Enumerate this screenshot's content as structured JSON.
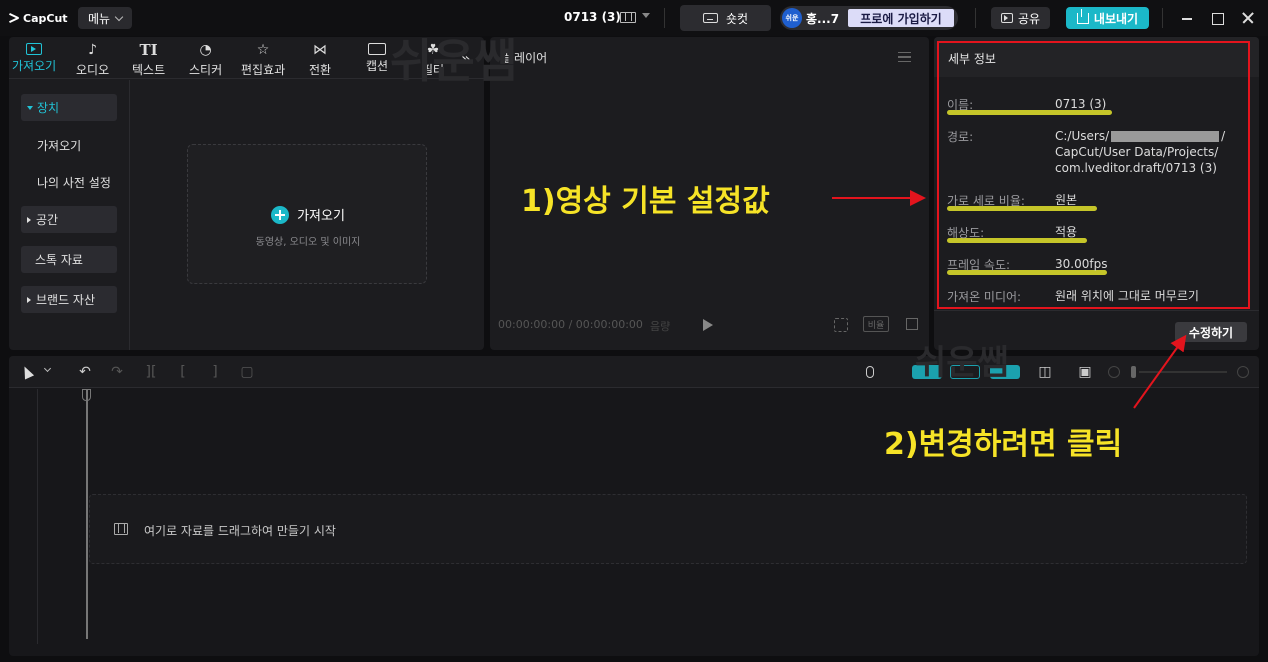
{
  "app": {
    "logo_text": "CapCut",
    "menu_label": "메뉴"
  },
  "topbar": {
    "project_title": "0713 (3)",
    "shortcut_label": "숏컷",
    "user_avatar_text": "쉬운",
    "user_name": "홍...7",
    "pro_label": "프로에 가입하기",
    "share_label": "공유",
    "export_label": "내보내기"
  },
  "media": {
    "tabs": [
      {
        "label": "가져오기",
        "icon": "import-icon"
      },
      {
        "label": "오디오",
        "icon": "audio-icon"
      },
      {
        "label": "텍스트",
        "icon": "text-icon"
      },
      {
        "label": "스티커",
        "icon": "sticker-icon"
      },
      {
        "label": "편집효과",
        "icon": "effects-icon"
      },
      {
        "label": "전환",
        "icon": "transition-icon"
      },
      {
        "label": "캡션",
        "icon": "caption-icon"
      },
      {
        "label": "필터",
        "icon": "filter-icon"
      }
    ],
    "tab_glyphs": {
      "audio": "♪",
      "text": "TI",
      "sticker": "◔",
      "effects": "☆",
      "transition": "⋈",
      "filter": "☘",
      "more": "»"
    },
    "side": {
      "device": "장치",
      "import": "가져오기",
      "my_presets": "나의 사전 설정",
      "space": "공간",
      "stock": "스톡 자료",
      "brand": "브랜드 자산"
    },
    "import_box": {
      "title": "가져오기",
      "subtitle": "동영상, 오디오 및 이미지"
    }
  },
  "player": {
    "title": "플레이어",
    "timecode": "00:00:00:00 / 00:00:00:00",
    "extra": "음량",
    "ratio_label": "비율"
  },
  "details": {
    "title": "세부 정보",
    "rows": [
      {
        "label": "이름:",
        "value": "0713 (3)"
      },
      {
        "label": "경로:",
        "value_lines": [
          "C:/Users/",
          "/",
          "CapCut/User Data/Projects/",
          "com.lveditor.draft/0713 (3)"
        ]
      },
      {
        "label": "가로 세로 비율:",
        "value": "원본"
      },
      {
        "label": "해상도:",
        "value": "적용"
      },
      {
        "label": "프레임 속도:",
        "value": "30.00fps"
      },
      {
        "label": "가져온 미디어:",
        "value": "원래 위치에 그대로 머무르기"
      }
    ],
    "edit_label": "수정하기"
  },
  "timeline": {
    "drop_text": "여기로 자료를 드래그하여 만들기 시작",
    "tool_glyphs": {
      "undo": "↶",
      "redo": "↷",
      "split": "][",
      "split_left": "[",
      "split_right": "]",
      "delete": "▢",
      "link": "⊶",
      "insert": "◫",
      "preview": "▣"
    }
  },
  "annotations": {
    "note1": "1)영상 기본 설정값",
    "note2": "2)변경하려면 클릭",
    "watermark": "쉬운쌤",
    "color": "#f6e327",
    "arrow_color": "#e3141d"
  },
  "colors": {
    "accent": "#1bb8c8",
    "highlight_frame": "#e3141d"
  }
}
